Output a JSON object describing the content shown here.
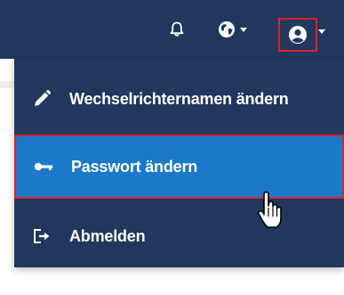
{
  "topbar": {
    "icons": [
      "bell-icon",
      "globe-icon",
      "user-icon"
    ],
    "background": "#21375e"
  },
  "menu": {
    "items": [
      {
        "label": "Wechselrichternamen ändern",
        "icon": "pencil-icon"
      },
      {
        "label": "Passwort ändern",
        "icon": "key-icon",
        "active": true
      },
      {
        "label": "Abmelden",
        "icon": "logout-icon"
      }
    ],
    "background": "#21375e",
    "active_background": "#1c78c8",
    "highlight_color": "#d9232d"
  }
}
